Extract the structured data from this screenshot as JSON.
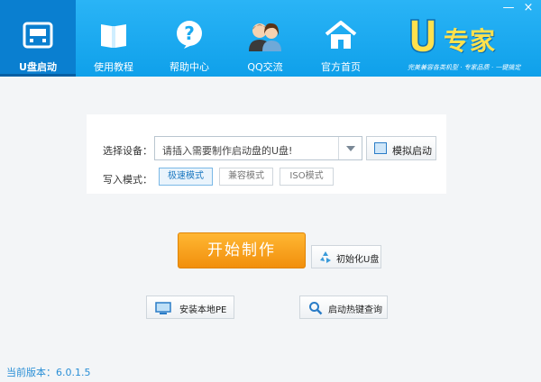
{
  "window_controls": {
    "minimize": "—",
    "close": "×"
  },
  "nav": [
    {
      "label": "U盘启动",
      "icon": "usb-drive-icon",
      "active": true
    },
    {
      "label": "使用教程",
      "icon": "book-icon",
      "active": false
    },
    {
      "label": "帮助中心",
      "icon": "help-icon",
      "active": false
    },
    {
      "label": "QQ交流",
      "icon": "people-icon",
      "active": false
    },
    {
      "label": "官方首页",
      "icon": "home-icon",
      "active": false
    }
  ],
  "logo": {
    "text": "专家",
    "slogan": "完美兼容各类机型 · 专家品质 · 一键搞定"
  },
  "device": {
    "label": "选择设备：",
    "value": "请插入需要制作启动盘的U盘!",
    "sim_label": "模拟启动"
  },
  "mode": {
    "label": "写入模式：",
    "options": [
      "极速模式",
      "兼容模式",
      "ISO模式"
    ],
    "selected": "极速模式"
  },
  "actions": {
    "start": "开始制作",
    "init": "初始化U盘",
    "install_pe": "安装本地PE",
    "hotkey": "启动热键查询"
  },
  "version": "当前版本：6.0.1.5",
  "colors": {
    "header": "#1aa9f0",
    "active_nav": "#0a7fd0",
    "start": "#f5a11c",
    "version": "#2a8fd6"
  }
}
